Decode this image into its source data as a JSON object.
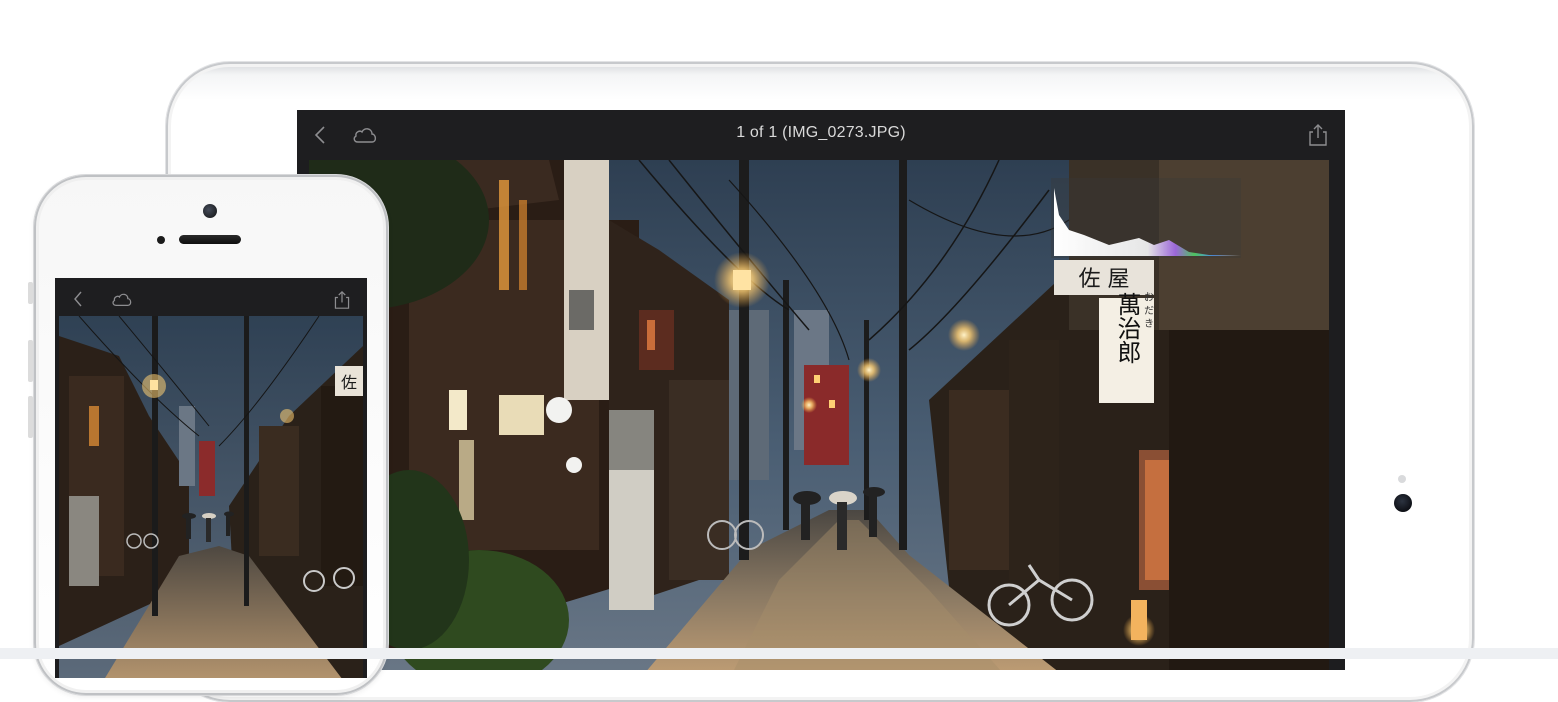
{
  "ipad": {
    "toolbar": {
      "title": "1 of 1 (IMG_0273.JPG)",
      "back_icon": "chevron-left-icon",
      "cloud_icon": "cloud-icon",
      "share_icon": "share-icon"
    },
    "histogram": {
      "visible": true
    },
    "photo": {
      "scene": "street-at-dusk",
      "signs": {
        "top": "佐 屋",
        "vertical_main": "萬治郎",
        "vertical_small": "お だ き"
      }
    }
  },
  "iphone": {
    "toolbar": {
      "back_icon": "chevron-left-icon",
      "cloud_icon": "cloud-icon",
      "share_icon": "share-icon"
    },
    "photo": {
      "scene": "street-at-dusk",
      "sign": "佐"
    }
  },
  "colors": {
    "toolbar_bg": "#1e1e20",
    "sky": "#3c4f63",
    "lamp": "#ffd98a",
    "device_frame": "#ffffff"
  }
}
